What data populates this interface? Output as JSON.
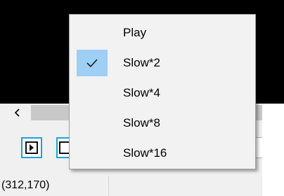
{
  "status": {
    "coordinates": "(312,170)"
  },
  "scrollbar": {
    "left_arrow_icon": "chevron-left-icon"
  },
  "toolbar": {
    "buttons": [
      "play-frame-icon",
      "step-frame-icon"
    ]
  },
  "context_menu": {
    "items": [
      {
        "label": "Play",
        "checked": false
      },
      {
        "label": "Slow*2",
        "checked": true
      },
      {
        "label": "Slow*4",
        "checked": false
      },
      {
        "label": "Slow*8",
        "checked": false
      },
      {
        "label": "Slow*16",
        "checked": false
      }
    ]
  },
  "colors": {
    "checked_highlight": "#9ecff5",
    "button_border": "#1aa3d8"
  }
}
